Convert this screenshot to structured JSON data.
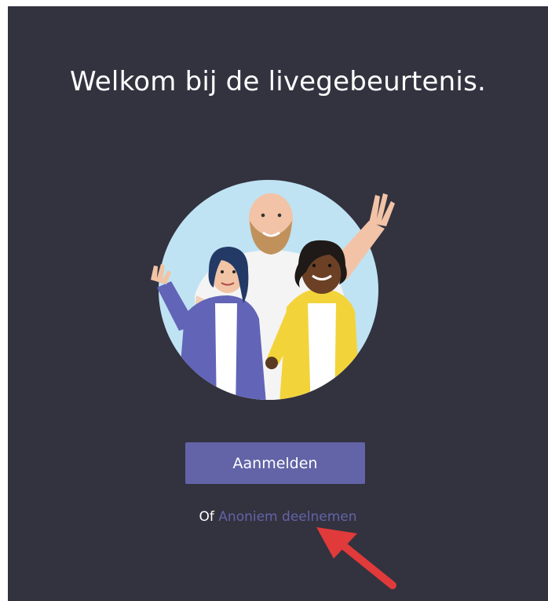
{
  "welcome": {
    "title": "Welkom bij de livegebeurtenis."
  },
  "actions": {
    "sign_in_label": "Aanmelden",
    "alt_prefix": "Of",
    "anonymous_link": "Anoniem deelnemen"
  },
  "colors": {
    "background": "#33323f",
    "accent": "#6264a7",
    "annotation_arrow": "#e03a3a"
  },
  "icons": {
    "illustration": "waving-people-illustration",
    "annotation": "red-arrow-icon"
  }
}
